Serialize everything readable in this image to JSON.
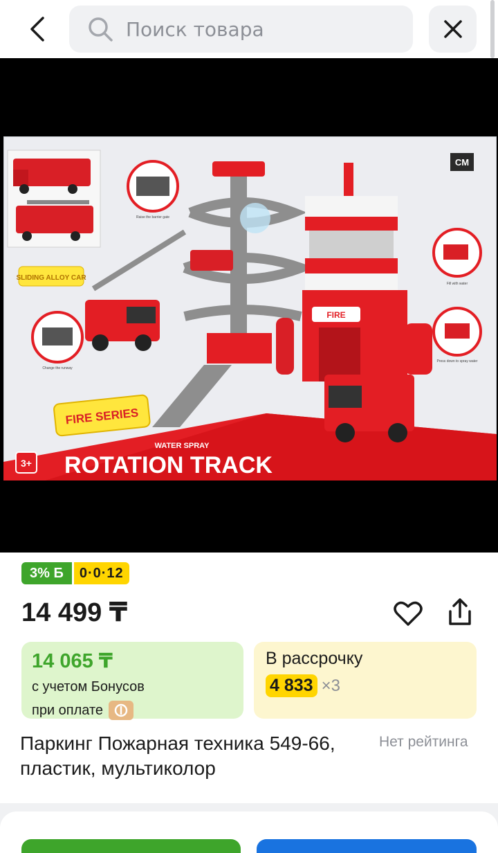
{
  "header": {
    "search_placeholder": "Поиск товара"
  },
  "product_image": {
    "box_brand": "CM",
    "sticker_label": "SLIDING ALLOY CAR",
    "series_label": "FIRE SERIES",
    "subtitle": "WATER SPRAY",
    "title": "ROTATION TRACK",
    "age_label": "3+",
    "station_sign": "FIRE",
    "caption_1": "Raise the barrier gate",
    "caption_2": "Change the runway",
    "caption_3": "Fill with water",
    "caption_4": "Press down to spray water"
  },
  "badges": {
    "bonus": "3% Б",
    "installment": "0·0·12"
  },
  "price": "14 499 ₸",
  "bonus_offer": {
    "price": "14 065 ₸",
    "line1": "с учетом Бонусов",
    "line2": "при оплате"
  },
  "installment_offer": {
    "label": "В рассрочку",
    "amount": "4 833",
    "multiplier": "×3"
  },
  "product": {
    "title": "Паркинг Пожарная техника 549-66, пластик, мультиколор",
    "rating": "Нет рейтинга"
  },
  "colors": {
    "accent_green": "#3ea52b",
    "accent_yellow": "#ffd500",
    "accent_blue": "#1973e0"
  }
}
